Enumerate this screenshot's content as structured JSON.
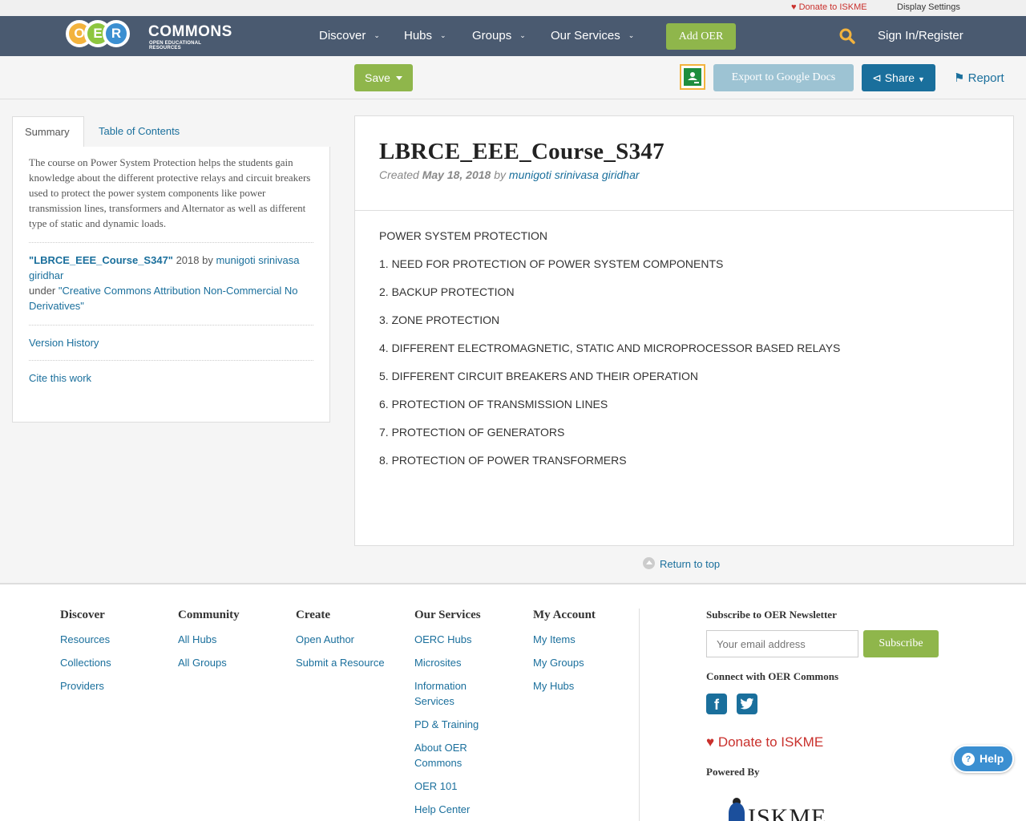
{
  "utility": {
    "donate": "Donate to ISKME",
    "display_settings": "Display Settings"
  },
  "logo": {
    "letters": [
      "O",
      "E",
      "R"
    ],
    "word": "COMMONS",
    "tagline": "OPEN EDUCATIONAL RESOURCES"
  },
  "nav": {
    "items": [
      {
        "label": "Discover"
      },
      {
        "label": "Hubs"
      },
      {
        "label": "Groups"
      },
      {
        "label": "Our Services"
      }
    ],
    "add_oer": "Add OER",
    "signin": "Sign In/Register"
  },
  "actions": {
    "save": "Save",
    "export": "Export to Google Docs",
    "share": "Share",
    "report": "Report"
  },
  "tabs": {
    "summary": "Summary",
    "toc": "Table of Contents"
  },
  "summary": {
    "text": "The course on Power System Protection helps the students gain knowledge about the different protective relays and circuit breakers used to protect the power system components like power transmission lines, transformers and Alternator as well as different type of static and dynamic loads.",
    "attr_title": "\"LBRCE_EEE_Course_S347\"",
    "attr_year_by": " 2018 by ",
    "attr_author": "munigoti srinivasa giridhar",
    "attr_under": "under ",
    "attr_license": "\"Creative Commons Attribution Non-Commercial No Derivatives\"",
    "version_history": "Version History",
    "cite": "Cite this work"
  },
  "content": {
    "title": "LBRCE_EEE_Course_S347",
    "created_label": "Created ",
    "created_date": "May 18, 2018",
    "by_label": " by ",
    "author": "munigoti srinivasa giridhar",
    "lines": [
      "POWER SYSTEM PROTECTION",
      "1. NEED FOR PROTECTION OF POWER SYSTEM COMPONENTS",
      "2. BACKUP PROTECTION",
      "3. ZONE PROTECTION",
      "4. DIFFERENT ELECTROMAGNETIC, STATIC AND MICROPROCESSOR BASED RELAYS",
      "5. DIFFERENT CIRCUIT BREAKERS AND THEIR OPERATION",
      "6. PROTECTION OF TRANSMISSION LINES",
      "7. PROTECTION OF GENERATORS",
      "8. PROTECTION OF POWER TRANSFORMERS"
    ]
  },
  "return_top": "Return to top",
  "footer": {
    "columns": [
      {
        "heading": "Discover",
        "links": [
          "Resources",
          "Collections",
          "Providers"
        ]
      },
      {
        "heading": "Community",
        "links": [
          "All Hubs",
          "All Groups"
        ]
      },
      {
        "heading": "Create",
        "links": [
          "Open Author",
          "Submit a Resource"
        ]
      },
      {
        "heading": "Our Services",
        "links": [
          "OERC Hubs",
          "Microsites",
          "Information Services",
          "PD & Training",
          "About OER Commons",
          "OER 101",
          "Help Center"
        ]
      },
      {
        "heading": "My Account",
        "links": [
          "My Items",
          "My Groups",
          "My Hubs"
        ]
      }
    ],
    "newsletter_heading": "Subscribe to OER Newsletter",
    "email_placeholder": "Your email address",
    "subscribe": "Subscribe",
    "connect": "Connect with OER Commons",
    "donate": "Donate to ISKME",
    "powered_by": "Powered By",
    "iskme": "ISKME"
  },
  "help": "Help",
  "colors": {
    "navbar": "#4a5a70",
    "accent_green": "#8fb64b",
    "link_blue": "#1a6f9c",
    "donate_red": "#c9302c"
  }
}
